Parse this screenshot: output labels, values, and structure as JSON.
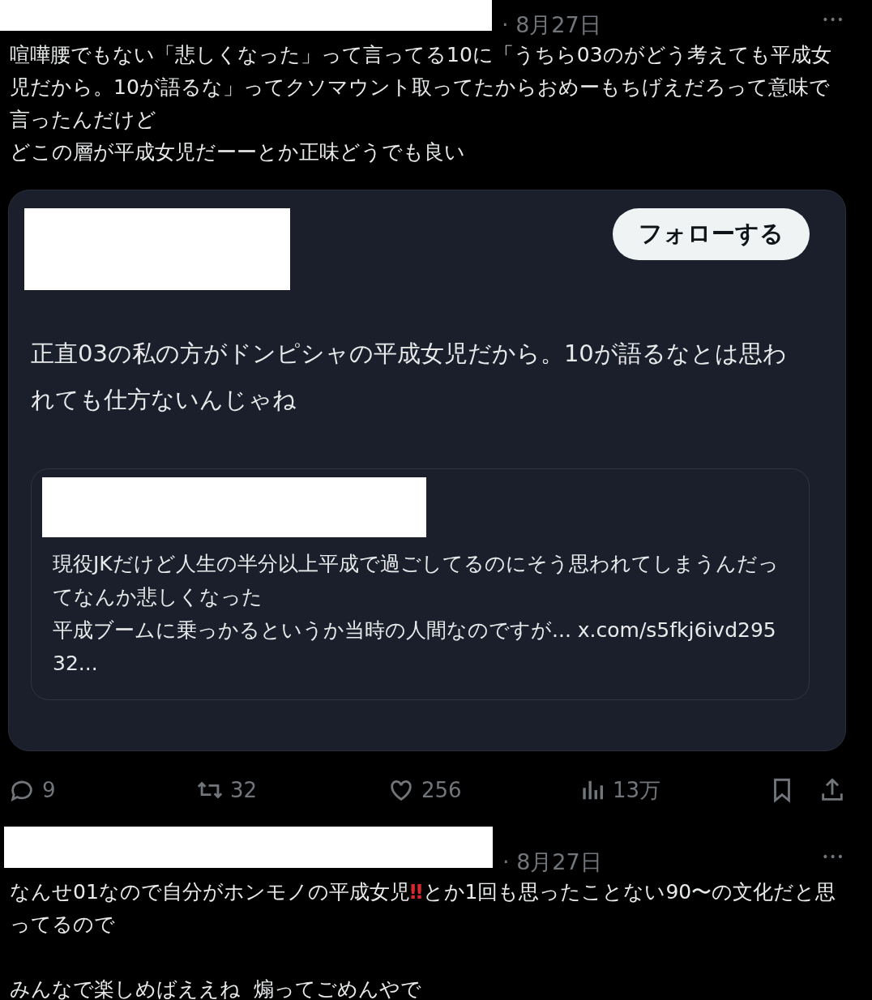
{
  "posts": [
    {
      "date": "· 8月27日",
      "more": "•••",
      "paragraphs": [
        {
          "spaced": false,
          "segments": [
            {
              "kind": "plain",
              "text": "喧嘩腰でもない「悲しくなった」って言ってる10に「うちら03のがどう考えても平成女児だから。10が語るな」ってクソマウント取ってたからおめーもちげえだろって意味で言ったんだけど"
            }
          ]
        },
        {
          "spaced": false,
          "segments": [
            {
              "kind": "plain",
              "text": "どこの層が平成女児だーーとか正味どうでも良い"
            }
          ]
        }
      ],
      "quote": {
        "follow_button": "フォローする",
        "text": "正直03の私の方がドンピシャの平成女児だから。10が語るなとは思われても仕方ないんじゃね",
        "inner_paragraphs": [
          "現役JKだけど人生の半分以上平成で過ごしてるのにそう思われてしまうんだってなんか悲しくなった",
          "平成ブームに乗っかるというか当時の人間なのですが... x.com/s5fkj6ivd29532..."
        ]
      },
      "actions": [
        {
          "kind": "reply",
          "count": "9"
        },
        {
          "kind": "repost",
          "count": "32"
        },
        {
          "kind": "like",
          "count": "256"
        },
        {
          "kind": "views",
          "count": "13万"
        },
        {
          "kind": "bookmark"
        },
        {
          "kind": "share"
        }
      ]
    },
    {
      "date": "· 8月27日",
      "more": "•••",
      "paragraphs": [
        {
          "spaced": false,
          "segments": [
            {
              "kind": "plain",
              "text": "なんせ01なので自分がホンモノの平成女児"
            },
            {
              "kind": "emoji",
              "text": "‼"
            },
            {
              "kind": "plain",
              "text": "とか1回も思ったことない90〜の文化だと思ってるので"
            }
          ]
        },
        {
          "spaced": true,
          "segments": [
            {
              "kind": "plain",
              "text": "みんなで楽しめばええね  煽ってごめんやで"
            }
          ]
        }
      ]
    }
  ]
}
